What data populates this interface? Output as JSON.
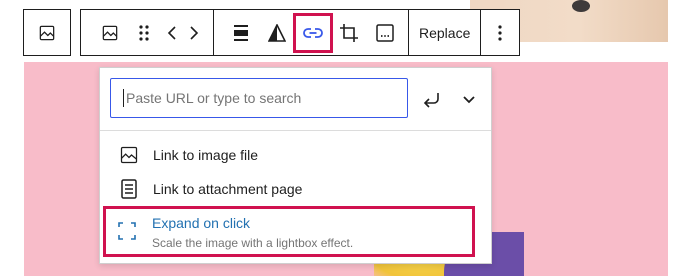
{
  "colors": {
    "accent_blue": "#3858e9",
    "link_blue": "#2271b1",
    "highlight_red": "#d0124f",
    "canvas_pink": "#f8bcc9"
  },
  "toolbar": {
    "block_type_icon": "image-icon",
    "change_type_icon": "image-icon",
    "drag_handle_icon": "drag-handle-icon",
    "move_left_icon": "chevron-left-icon",
    "move_right_icon": "chevron-right-icon",
    "align_icon": "align-wide-icon",
    "duotone_icon": "duotone-icon",
    "link_icon": "link-icon",
    "crop_icon": "crop-icon",
    "caption_icon": "caption-icon",
    "replace_label": "Replace",
    "more_icon": "more-vertical-icon"
  },
  "link_popover": {
    "search": {
      "value": "",
      "placeholder": "Paste URL or type to search"
    },
    "submit_icon": "enter-return-icon",
    "options_icon": "chevron-down-icon",
    "items": [
      {
        "icon": "image-icon",
        "label": "Link to image file"
      },
      {
        "icon": "page-icon",
        "label": "Link to attachment page"
      }
    ],
    "expand": {
      "icon": "fullscreen-icon",
      "title": "Expand on click",
      "description": "Scale the image with a lightbox effect."
    }
  }
}
